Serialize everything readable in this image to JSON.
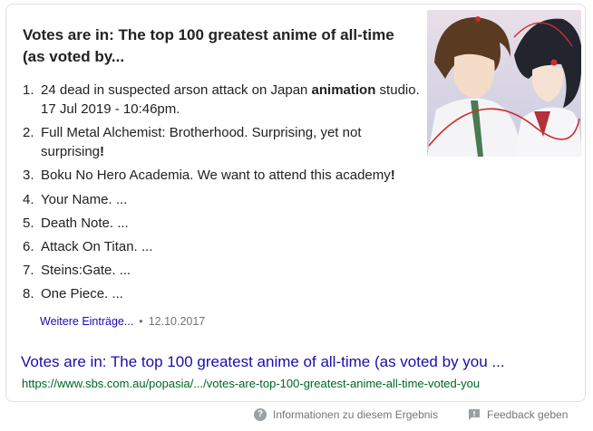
{
  "card": {
    "headline": "Votes are in: The top 100 greatest anime of all-time (as voted by...",
    "list": [
      {
        "num": "1.",
        "pre": "24 dead in suspected arson attack on Japan ",
        "bold": "animation",
        "post": " studio. 17 Jul 2019 - 10:46pm."
      },
      {
        "num": "2.",
        "pre": "Full Metal Alchemist: Brotherhood. Surprising, yet not surprising",
        "bold": "!",
        "post": ""
      },
      {
        "num": "3.",
        "pre": "Boku No Hero Academia. We want to attend this academy",
        "bold": "!",
        "post": ""
      },
      {
        "num": "4.",
        "pre": "Your Name. ...",
        "bold": "",
        "post": ""
      },
      {
        "num": "5.",
        "pre": "Death Note. ...",
        "bold": "",
        "post": ""
      },
      {
        "num": "6.",
        "pre": "Attack On Titan. ...",
        "bold": "",
        "post": ""
      },
      {
        "num": "7.",
        "pre": "Steins:Gate. ...",
        "bold": "",
        "post": ""
      },
      {
        "num": "8.",
        "pre": "One Piece. ...",
        "bold": "",
        "post": ""
      }
    ],
    "more_link": "Weitere Einträge...",
    "separator": "•",
    "date": "12.10.2017",
    "result_title": "Votes are in: The top 100 greatest anime of all-time (as voted by you ...",
    "result_url": "https://www.sbs.com.au/popasia/.../votes-are-top-100-greatest-anime-all-time-voted-you"
  },
  "footer": {
    "info_icon_glyph": "?",
    "info_label": "Informationen zu diesem Ergebnis",
    "feedback_icon": "feedback-flag-icon",
    "feedback_label": "Feedback geben"
  },
  "colors": {
    "link": "#1a0dab",
    "url": "#006621",
    "meta": "#70757a",
    "border": "#dfe1e5"
  }
}
